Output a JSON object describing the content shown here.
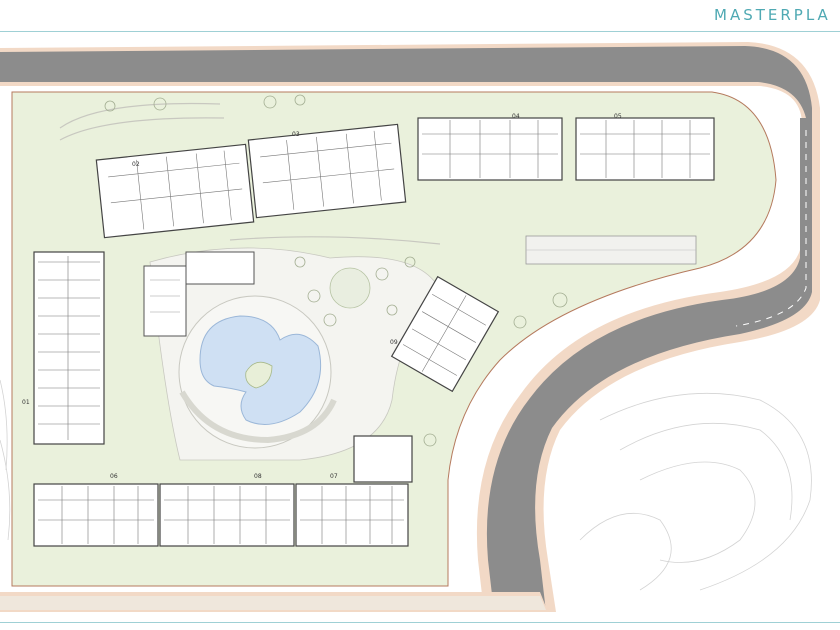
{
  "header": {
    "title": "MASTERPLA"
  },
  "blocks": [
    {
      "label": "01"
    },
    {
      "label": "02"
    },
    {
      "label": "03"
    },
    {
      "label": "04"
    },
    {
      "label": "05"
    },
    {
      "label": "06"
    },
    {
      "label": "07"
    },
    {
      "label": "08"
    },
    {
      "label": "09"
    }
  ],
  "colors": {
    "accent": "#4fa9b3",
    "road": "#8c8c8c",
    "sidewalk": "#f2d9c6",
    "lawn": "#eaf1dc",
    "pool": "#cfe0f3",
    "plaza": "#f4f4f0"
  }
}
